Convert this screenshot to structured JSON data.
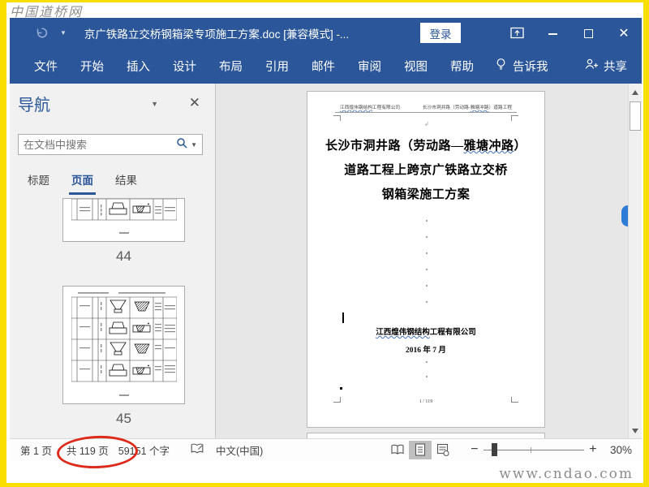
{
  "watermarks": {
    "top": "中国道桥网",
    "bottom": "www.cndao.com"
  },
  "title_bar": {
    "document_title": "京广铁路立交桥钢箱梁专项施工方案.doc [兼容模式]  -...",
    "login_button": "登录"
  },
  "ribbon": {
    "tabs": [
      "文件",
      "开始",
      "插入",
      "设计",
      "布局",
      "引用",
      "邮件",
      "审阅",
      "视图",
      "帮助"
    ],
    "tell_me_label": "告诉我",
    "share_label": "共享"
  },
  "navigation_pane": {
    "title": "导航",
    "search_placeholder": "在文档中搜索",
    "tabs": [
      {
        "label": "标题",
        "active": false
      },
      {
        "label": "页面",
        "active": true
      },
      {
        "label": "结果",
        "active": false
      }
    ],
    "thumbnails": [
      {
        "page_number": "44"
      },
      {
        "page_number": "45"
      }
    ]
  },
  "document": {
    "header_left": {
      "wavy": "江西煌伟钢结构",
      "post": "工程有限公司"
    },
    "header_right": {
      "pre": "长沙市洞井路（劳动路-",
      "wavy": "雅塘冲路",
      "post": "）道路工程"
    },
    "title_lines": [
      {
        "pre": "长沙市洞井路（劳动路—",
        "wavy": "雅塘冲路",
        "post": "）"
      },
      {
        "pre": "道路工程上跨京广铁路立交桥",
        "wavy": "",
        "post": ""
      },
      {
        "pre": "钢箱梁施工方案",
        "wavy": "",
        "post": ""
      }
    ],
    "company": {
      "wavy": "江西煌伟钢结构",
      "post": "工程有限公司"
    },
    "date": "2016 年 7 月",
    "page_footer": "1 / 119"
  },
  "status_bar": {
    "current_page": "第 1 页",
    "total_pages": "共 119 页",
    "word_count": "59151 个字",
    "language": "中文(中国)",
    "zoom_percent": "30%"
  },
  "colors": {
    "accent_blue": "#2B579A",
    "frame_yellow": "#F8DF00",
    "annotation_red": "#DD2A1A",
    "squiggle_blue": "#4472C4"
  }
}
